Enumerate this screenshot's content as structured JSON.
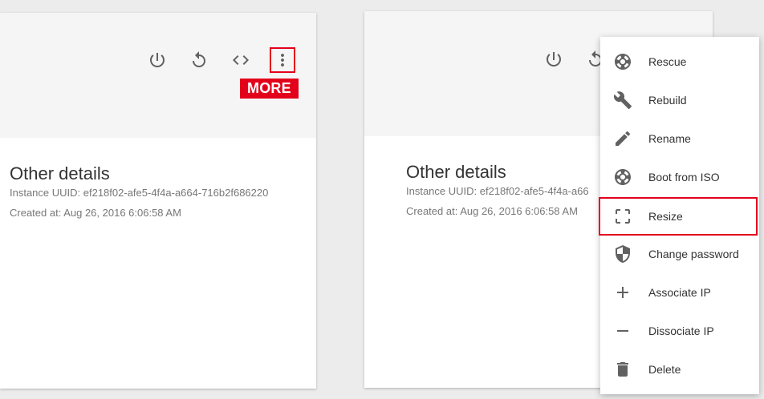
{
  "left_card": {
    "details_title": "Other details",
    "uuid_line": "Instance UUID: ef218f02-afe5-4f4a-a664-716b2f686220",
    "created_line": "Created at: Aug 26, 2016 6:06:58 AM",
    "more_label": "MORE"
  },
  "right_card": {
    "details_title": "Other details",
    "uuid_line": "Instance UUID: ef218f02-afe5-4f4a-a66",
    "created_line": "Created at: Aug 26, 2016 6:06:58 AM"
  },
  "menu": {
    "items": [
      {
        "label": "Rescue",
        "icon": "lifebuoy-icon"
      },
      {
        "label": "Rebuild",
        "icon": "wrench-icon"
      },
      {
        "label": "Rename",
        "icon": "pencil-icon"
      },
      {
        "label": "Boot from ISO",
        "icon": "lifebuoy-icon"
      },
      {
        "label": "Resize",
        "icon": "resize-icon",
        "highlighted": true
      },
      {
        "label": "Change password",
        "icon": "shield-icon"
      },
      {
        "label": "Associate IP",
        "icon": "plus-icon"
      },
      {
        "label": "Dissociate IP",
        "icon": "minus-icon"
      },
      {
        "label": "Delete",
        "icon": "trash-icon"
      }
    ]
  },
  "colors": {
    "highlight": "#e3001b",
    "icon": "#616161",
    "header_bg": "#f5f5f5",
    "page_bg": "#ececec"
  }
}
